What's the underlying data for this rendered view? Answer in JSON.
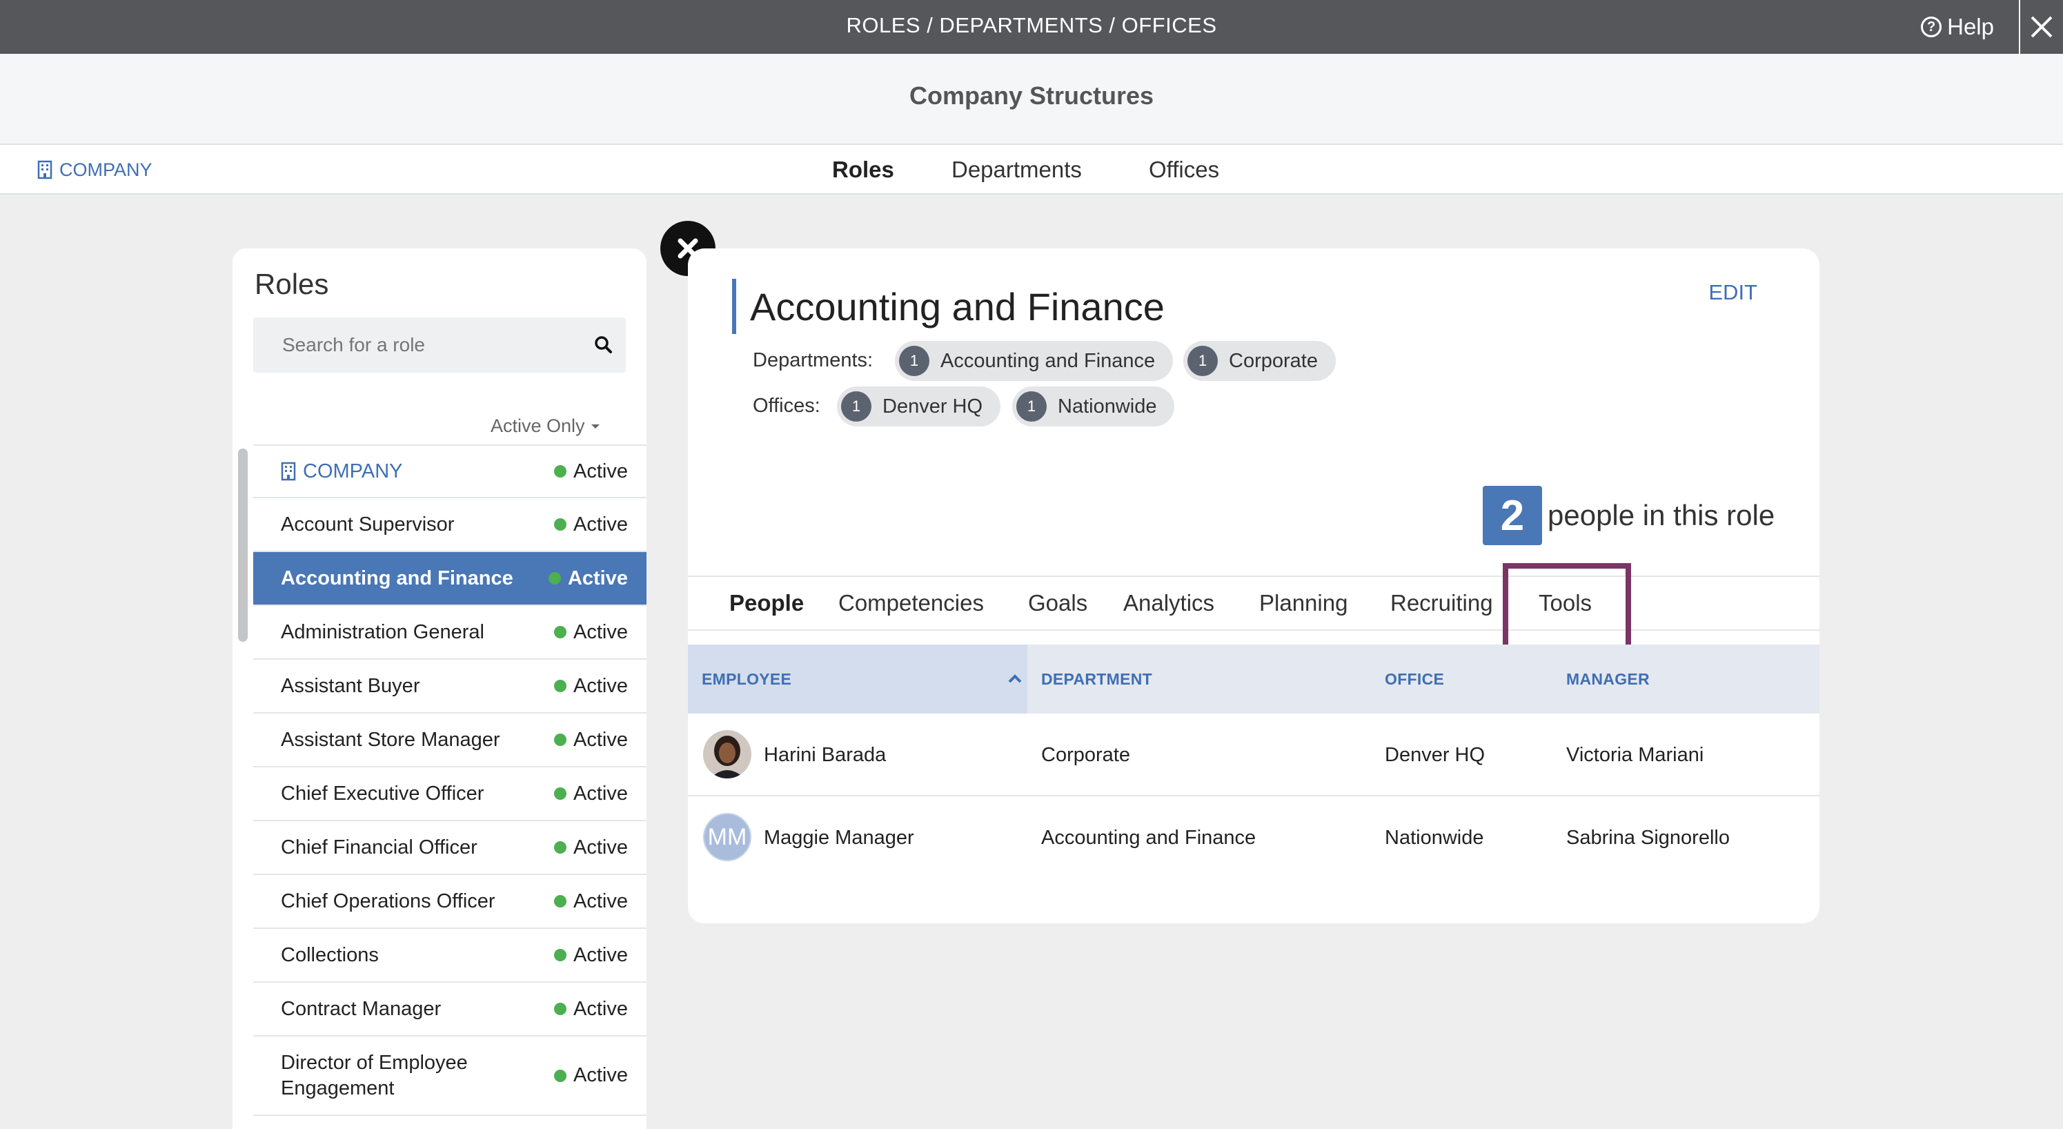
{
  "topbar": {
    "title": "ROLES / DEPARTMENTS / OFFICES",
    "help_label": "Help"
  },
  "header": {
    "title": "Company Structures"
  },
  "nav": {
    "company_link": "COMPANY",
    "tabs": [
      {
        "label": "Roles",
        "active": true
      },
      {
        "label": "Departments",
        "active": false
      },
      {
        "label": "Offices",
        "active": false
      }
    ]
  },
  "roles_panel": {
    "heading": "Roles",
    "search_placeholder": "Search for a role",
    "filter_label": "Active Only",
    "items": [
      {
        "name": "COMPANY",
        "status": "Active"
      },
      {
        "name": "Account Supervisor",
        "status": "Active"
      },
      {
        "name": "Accounting and Finance",
        "status": "Active"
      },
      {
        "name": "Administration General",
        "status": "Active"
      },
      {
        "name": "Assistant Buyer",
        "status": "Active"
      },
      {
        "name": "Assistant Store Manager",
        "status": "Active"
      },
      {
        "name": "Chief Executive Officer",
        "status": "Active"
      },
      {
        "name": "Chief Financial Officer",
        "status": "Active"
      },
      {
        "name": "Chief Operations Officer",
        "status": "Active"
      },
      {
        "name": "Collections",
        "status": "Active"
      },
      {
        "name": "Contract Manager",
        "status": "Active"
      },
      {
        "name": "Director of Employee Engagement",
        "status": "Active"
      }
    ],
    "selected": "Accounting and Finance"
  },
  "detail": {
    "title": "Accounting and Finance",
    "edit_label": "EDIT",
    "departments_label": "Departments:",
    "departments": [
      {
        "count": "1",
        "name": "Accounting and Finance"
      },
      {
        "count": "1",
        "name": "Corporate"
      }
    ],
    "offices_label": "Offices:",
    "offices": [
      {
        "count": "1",
        "name": "Denver HQ"
      },
      {
        "count": "1",
        "name": "Nationwide"
      }
    ],
    "people_count": "2",
    "people_text": "people in this role",
    "tabs": [
      {
        "label": "People",
        "active": true
      },
      {
        "label": "Competencies",
        "active": false
      },
      {
        "label": "Goals",
        "active": false
      },
      {
        "label": "Analytics",
        "active": false
      },
      {
        "label": "Planning",
        "active": false
      },
      {
        "label": "Recruiting",
        "active": false
      },
      {
        "label": "Tools",
        "active": false,
        "highlighted": true
      }
    ],
    "table": {
      "headers": [
        "EMPLOYEE",
        "DEPARTMENT",
        "OFFICE",
        "MANAGER"
      ],
      "rows": [
        {
          "avatar": "photo",
          "employee": "Harini Barada",
          "department": "Corporate",
          "office": "Denver HQ",
          "manager": "Victoria Mariani"
        },
        {
          "avatar": "MM",
          "employee": "Maggie Manager",
          "department": "Accounting and Finance",
          "office": "Nationwide",
          "manager": "Sabrina Signorello"
        }
      ]
    }
  },
  "colors": {
    "topbar": "#56575a",
    "accent_blue": "#4a77b5",
    "link_blue": "#3f6fb4",
    "active_green": "#4caf50",
    "highlight_box": "#7a3565"
  }
}
